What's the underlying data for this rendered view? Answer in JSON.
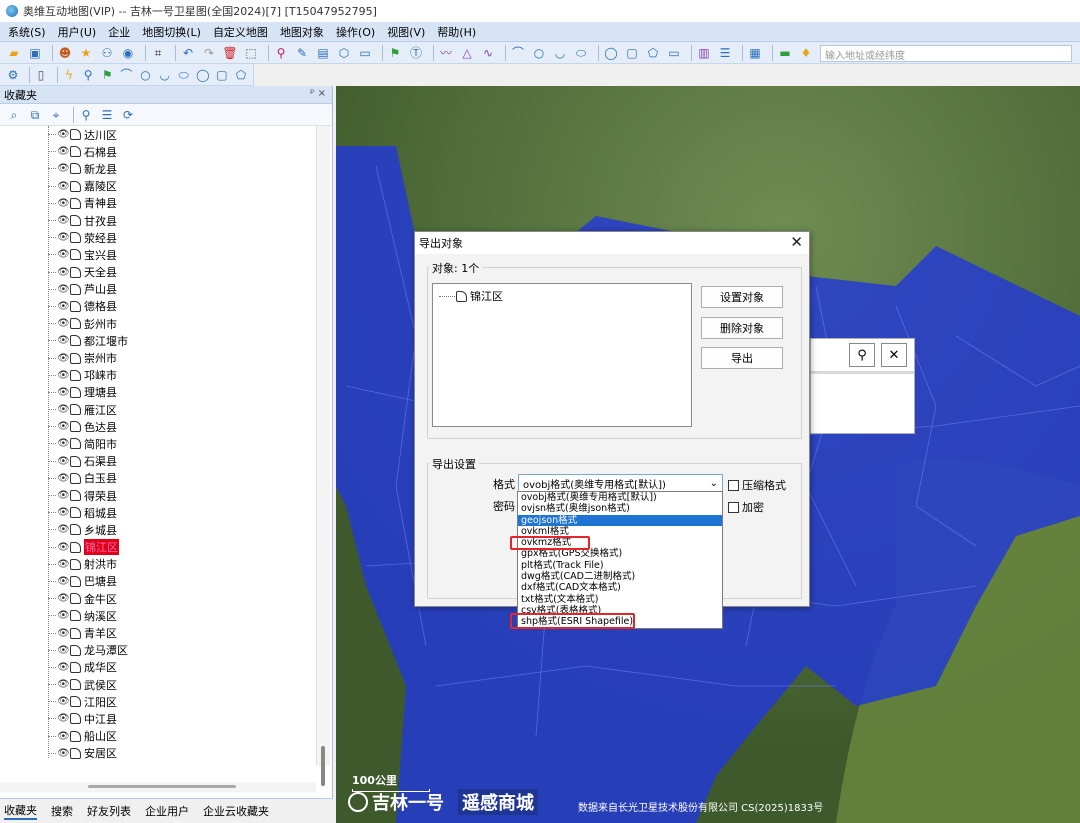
{
  "window": {
    "title": "奥维互动地图(VIP) -- 吉林一号卫星图(全国2024)[7] [T15047952795]"
  },
  "menu": [
    "系统(S)",
    "用户(U)",
    "企业",
    "地图切换(L)",
    "自定义地图",
    "地图对象",
    "操作(O)",
    "视图(V)",
    "帮助(H)"
  ],
  "search": {
    "placeholder": "输入地址或经纬度"
  },
  "panel": {
    "title": "收藏夹",
    "controls": "ᵖ ×",
    "tree_items": [
      "达川区",
      "石棉县",
      "新龙县",
      "嘉陵区",
      "青神县",
      "甘孜县",
      "荥经县",
      "宝兴县",
      "天全县",
      "芦山县",
      "德格县",
      "彭州市",
      "都江堰市",
      "崇州市",
      "邛崃市",
      "理塘县",
      "雁江区",
      "色达县",
      "简阳市",
      "石渠县",
      "白玉县",
      "得荣县",
      "稻城县",
      "乡城县",
      "锦江区",
      "射洪市",
      "巴塘县",
      "金牛区",
      "纳溪区",
      "青羊区",
      "龙马潭区",
      "成华区",
      "武侯区",
      "江阳区",
      "中江县",
      "船山区",
      "安居区"
    ],
    "selected_item": "锦江区",
    "bottom_tabs": [
      "收藏夹",
      "搜索",
      "好友列表",
      "企业用户",
      "企业云收藏夹"
    ]
  },
  "dialog": {
    "title": "导出对象",
    "objects_label": "对象: 1个",
    "object_item": "锦江区",
    "buttons": {
      "set": "设置对象",
      "delete": "删除对象",
      "export": "导出"
    },
    "settings_label": "导出设置",
    "format_label": "格式",
    "password_label": "密码",
    "format_value": "ovobj格式(奥维专用格式[默认])",
    "compress_label": "压缩格式",
    "encrypt_label": "加密"
  },
  "dropdown_options": [
    "ovobj格式(奥维专用格式[默认])",
    "ovjsn格式(奥维json格式)",
    "geojson格式",
    "ovkml格式",
    "ovkmz格式",
    "gpx格式(GPS交换格式)",
    "plt格式(Track File)",
    "dwg格式(CAD二进制格式)",
    "dxf格式(CAD文本格式)",
    "txt格式(文本格式)",
    "csv格式(表格格式)",
    "shp格式(ESRI Shapefile)"
  ],
  "highlighted_option": "geojson格式",
  "map": {
    "scale": "100公里",
    "logo_primary": "吉林一号",
    "logo_secondary": "遥感商城",
    "credit": "数据来自长光卫星技术股份有限公司 CS(2025)1833号"
  },
  "colors": {
    "region_fill": "#2238d8",
    "highlight_red": "#e2262b",
    "menu_bg": "#d6e4f5"
  }
}
